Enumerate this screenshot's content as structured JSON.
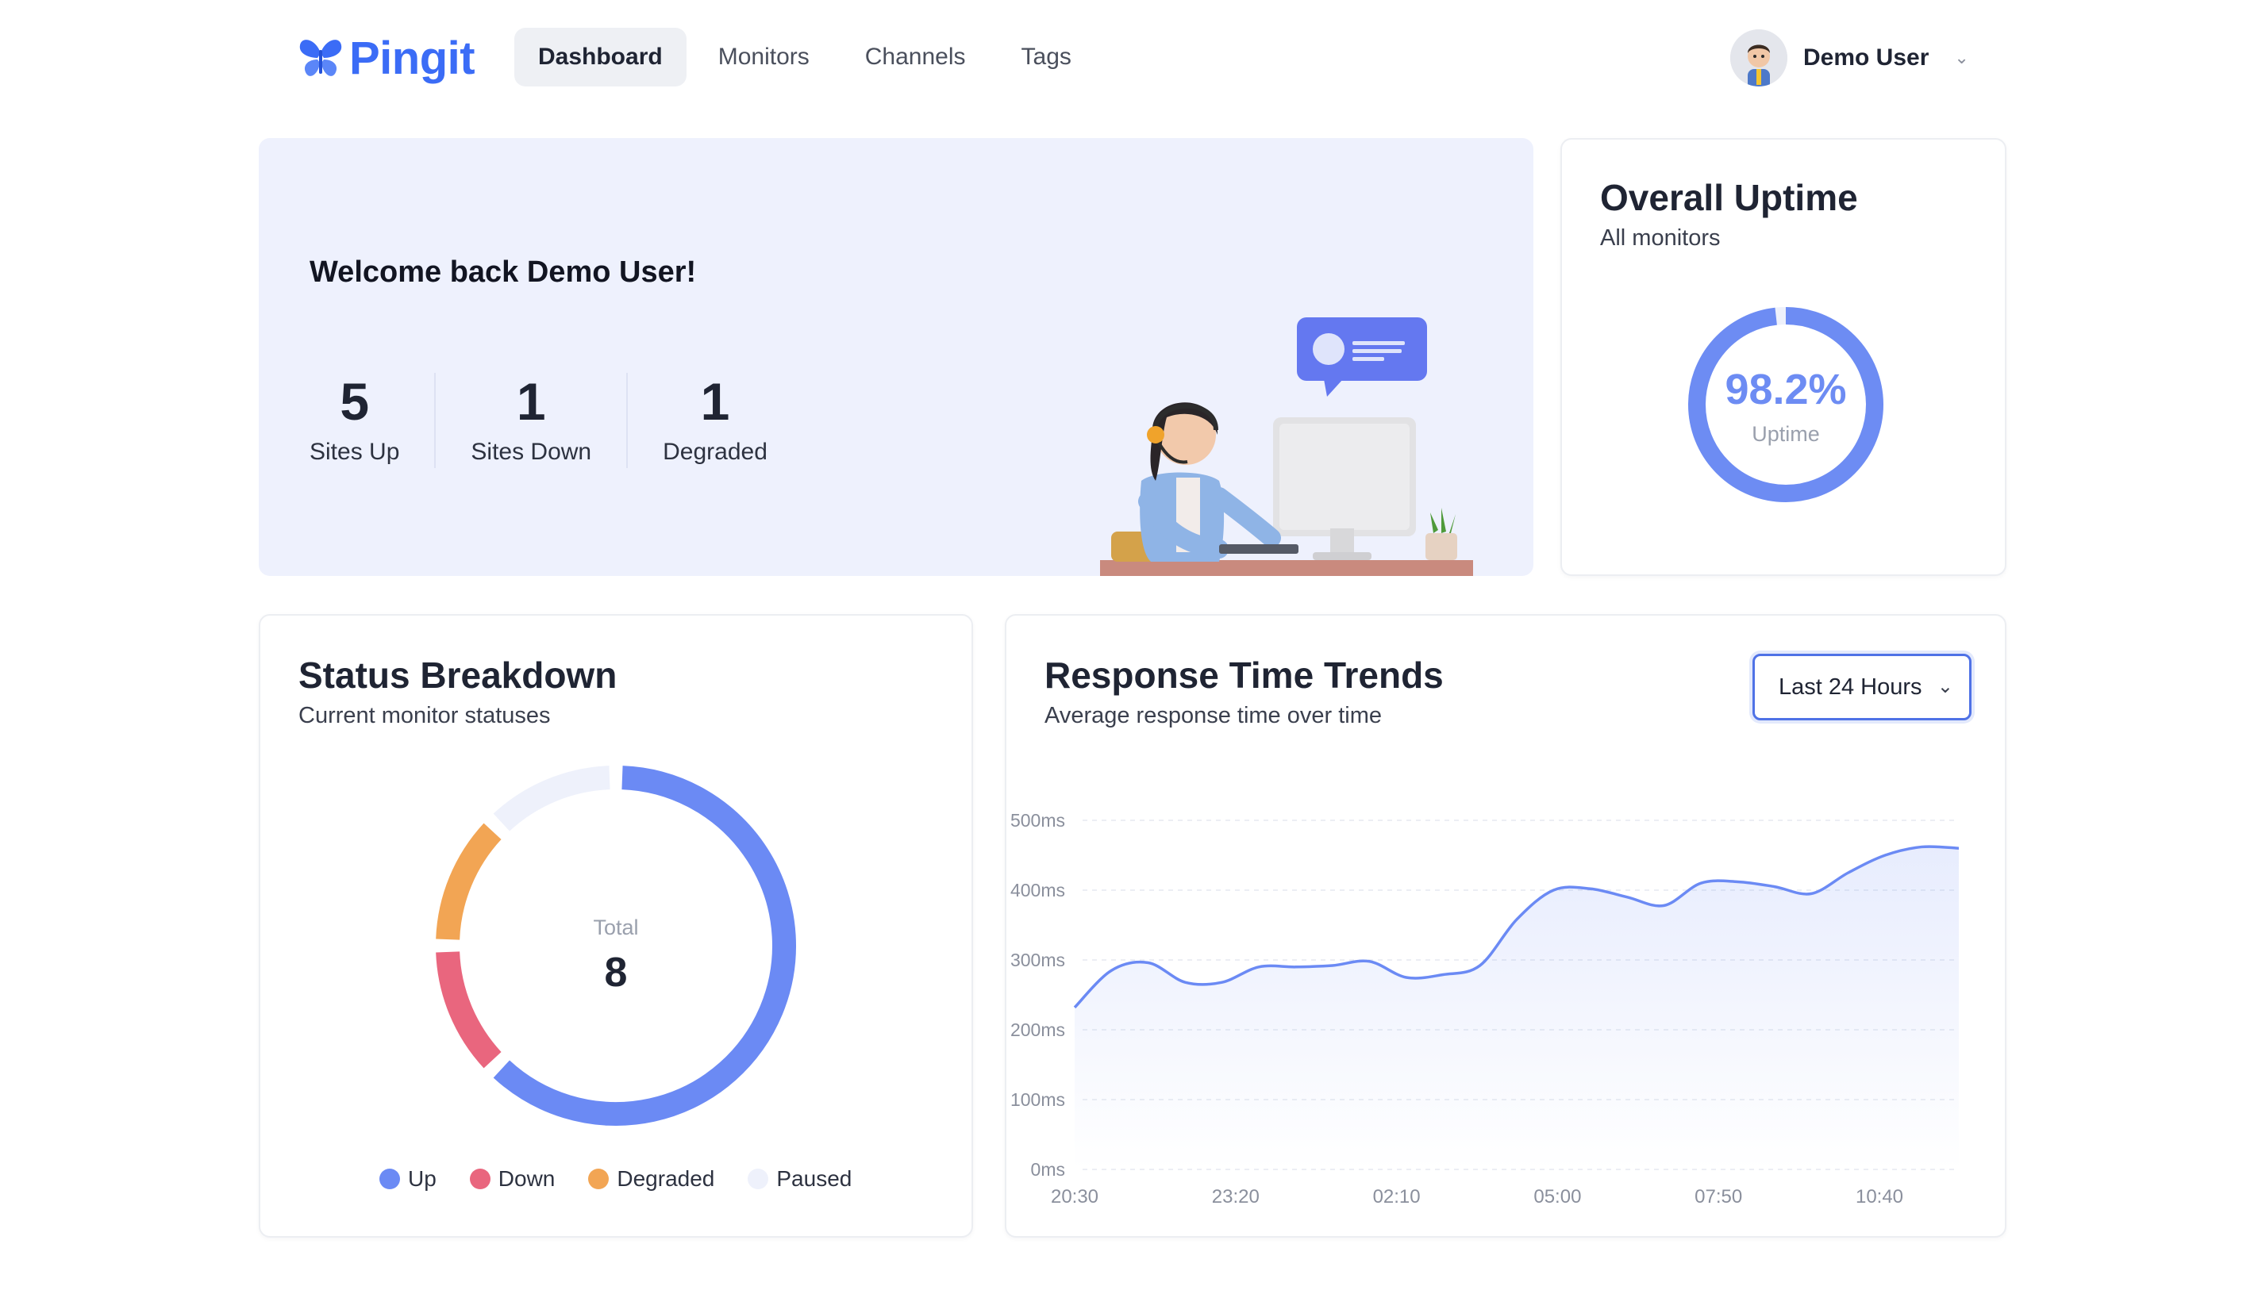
{
  "app": {
    "name": "Pingit",
    "brand_color": "#3b6cf6"
  },
  "nav": {
    "items": [
      {
        "label": "Dashboard",
        "active": true
      },
      {
        "label": "Monitors",
        "active": false
      },
      {
        "label": "Channels",
        "active": false
      },
      {
        "label": "Tags",
        "active": false
      }
    ]
  },
  "user": {
    "name": "Demo User",
    "avatar_icon": "user-avatar-icon",
    "menu_icon": "chevron-down-icon"
  },
  "welcome": {
    "title": "Welcome back Demo User!",
    "stats": [
      {
        "value": "5",
        "label": "Sites Up"
      },
      {
        "value": "1",
        "label": "Sites Down"
      },
      {
        "value": "1",
        "label": "Degraded"
      }
    ]
  },
  "uptime": {
    "title": "Overall Uptime",
    "subtitle": "All monitors",
    "value_text": "98.2%",
    "value": 98.2,
    "label": "Uptime",
    "color": "#6d8cf3"
  },
  "breakdown": {
    "title": "Status Breakdown",
    "subtitle": "Current monitor statuses",
    "center_label": "Total",
    "center_value": "8",
    "legend": [
      {
        "label": "Up",
        "value": 5,
        "color": "#6b8af4"
      },
      {
        "label": "Down",
        "value": 1,
        "color": "#e9667e"
      },
      {
        "label": "Degraded",
        "value": 1,
        "color": "#f2a554"
      },
      {
        "label": "Paused",
        "value": 1,
        "color": "#eef1fb"
      }
    ]
  },
  "trends": {
    "title": "Response Time Trends",
    "subtitle": "Average response time over time",
    "range_select": {
      "value": "Last 24 Hours",
      "icon": "chevron-down-icon"
    }
  },
  "chart_data": [
    {
      "type": "pie",
      "categories": [
        "Up",
        "Down",
        "Degraded",
        "Paused"
      ],
      "values": [
        5,
        1,
        1,
        1
      ],
      "colors": [
        "#6b8af4",
        "#e9667e",
        "#f2a554",
        "#eef1fb"
      ],
      "center": "Total 8",
      "legend": "bottom"
    },
    {
      "type": "area",
      "x": [
        "20:30",
        "21:10",
        "21:50",
        "22:30",
        "23:10",
        "23:50",
        "00:30",
        "01:10",
        "01:50",
        "02:30",
        "03:10",
        "03:50",
        "04:30",
        "05:10",
        "05:50",
        "06:30",
        "07:10",
        "07:50",
        "08:30",
        "09:10",
        "09:50",
        "10:30",
        "11:10",
        "11:50",
        "12:30"
      ],
      "series": [
        {
          "values": [
            232,
            285,
            296,
            268,
            268,
            290,
            290,
            292,
            298,
            275,
            279,
            292,
            358,
            400,
            402,
            390,
            378,
            410,
            412,
            405,
            395,
            425,
            450,
            462,
            460
          ],
          "color": "#6b8af4"
        }
      ],
      "xticks": [
        "20:30",
        "23:20",
        "02:10",
        "05:00",
        "07:50",
        "10:40"
      ],
      "yticks": [
        "0ms",
        "100ms",
        "200ms",
        "300ms",
        "400ms",
        "500ms"
      ],
      "ylim": [
        0,
        500
      ],
      "grid": true,
      "legend": "none"
    }
  ]
}
